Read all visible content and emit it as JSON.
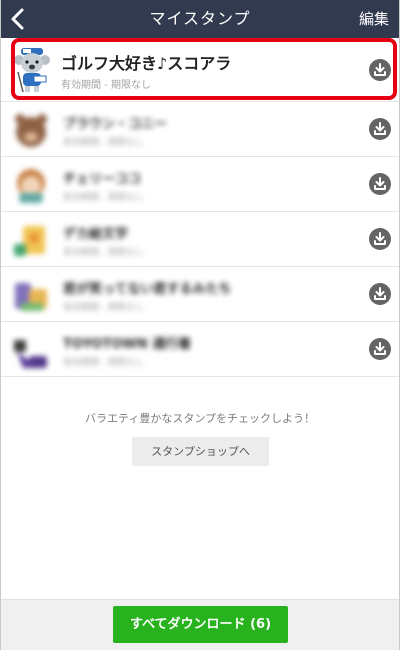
{
  "header": {
    "title": "マイスタンプ",
    "edit_label": "編集"
  },
  "stamps": [
    {
      "name": "ゴルフ大好き♪スコアラ",
      "validity": "有効期間 - 期限なし",
      "blurred": false
    },
    {
      "name": "ブラウン・コニー",
      "validity": "有効期間 - 期限なし",
      "blurred": true
    },
    {
      "name": "チェリーココ",
      "validity": "有効期間 - 期限なし",
      "blurred": true
    },
    {
      "name": "デカ絵文字",
      "validity": "有効期間 - 期限なし",
      "blurred": true
    },
    {
      "name": "君が笑ってない君するみたち",
      "validity": "有効期間 - 期限なし",
      "blurred": true
    },
    {
      "name": "TOYOTOWN 通行着",
      "validity": "有効期間 - 期限なし",
      "blurred": true
    }
  ],
  "promo": {
    "message": "バラエティ豊かなスタンプをチェックしよう！",
    "shop_button": "スタンプショップへ"
  },
  "footer": {
    "download_all": "すべてダウンロード (6)"
  },
  "colors": {
    "header_bg": "#313a4f",
    "highlight": "#e60012",
    "download_all_bg": "#28b21e",
    "download_icon_bg": "#646464"
  }
}
